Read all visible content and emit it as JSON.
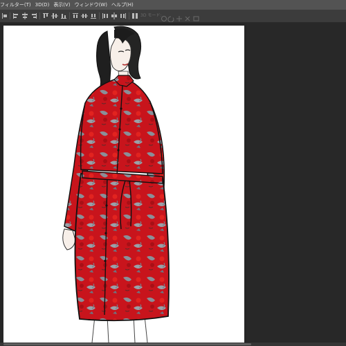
{
  "menubar": {
    "items": [
      "フィルター(T)",
      "3D(D)",
      "表示(V)",
      "ウィンドウ(W)",
      "ヘルプ(H)"
    ]
  },
  "options_bar": {
    "mode_3d_label": "3D モード:"
  },
  "canvas": {
    "artwork": "fashion illustration of a woman wearing a red floral long-sleeve shirt dress with waist tie"
  },
  "colors": {
    "menubar_bg": "#535353",
    "optionsbar_bg": "#3c3c3c",
    "workspace_bg": "#262626",
    "dress_red": "#c8141c",
    "print_gray": "#8a8f98"
  }
}
